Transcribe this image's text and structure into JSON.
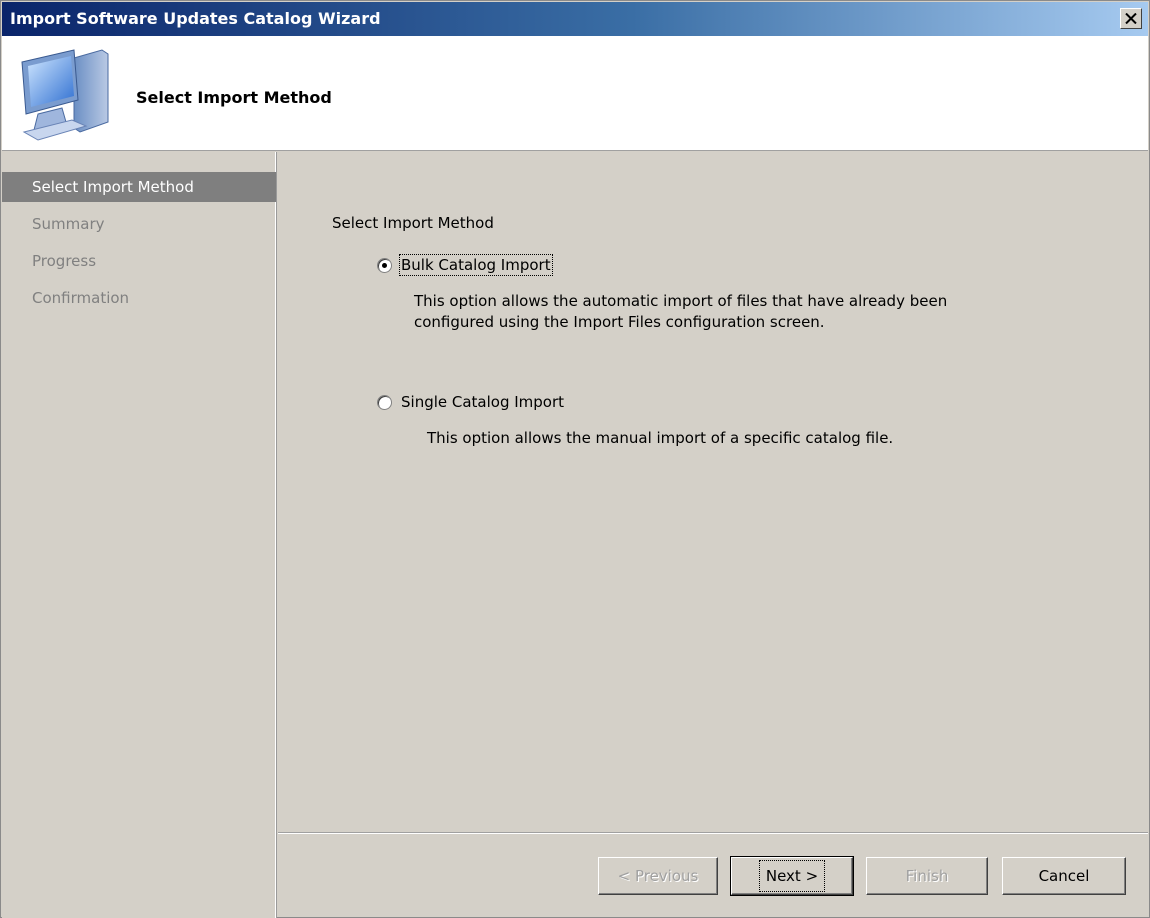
{
  "window": {
    "title": "Import Software Updates Catalog Wizard",
    "close_icon": "close-icon"
  },
  "header": {
    "title": "Select Import Method",
    "icon": "computer-icon"
  },
  "sidebar": {
    "items": [
      {
        "label": "Select Import Method",
        "active": true
      },
      {
        "label": "Summary",
        "active": false
      },
      {
        "label": "Progress",
        "active": false
      },
      {
        "label": "Confirmation",
        "active": false
      }
    ]
  },
  "main": {
    "section_label": "Select Import Method",
    "options": [
      {
        "label": "Bulk Catalog Import",
        "selected": true,
        "description": "This option allows the automatic import of files that have already been configured using the Import Files configuration screen."
      },
      {
        "label": "Single Catalog Import",
        "selected": false,
        "description": "This option allows the manual import of a specific catalog file."
      }
    ]
  },
  "buttons": {
    "previous": "< Previous",
    "next": "Next >",
    "finish": "Finish",
    "cancel": "Cancel"
  }
}
